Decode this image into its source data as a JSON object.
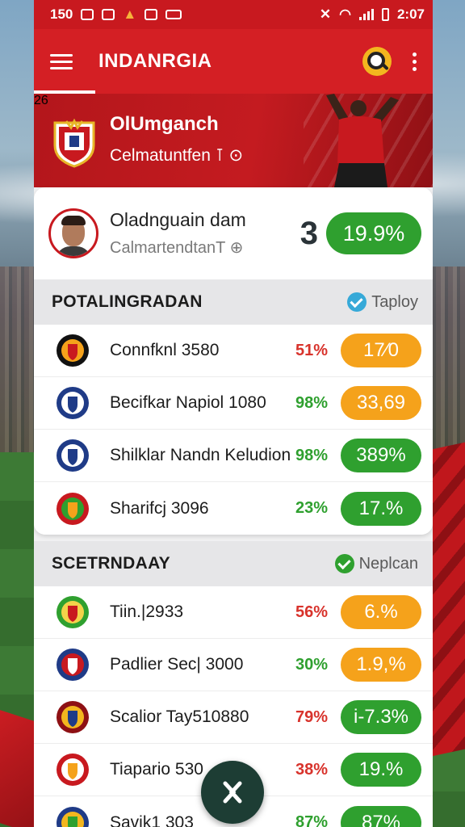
{
  "status_bar": {
    "left_time": "150",
    "right_time": "2:07"
  },
  "app_bar": {
    "title": "INDANRGIA"
  },
  "hero": {
    "name": "OlUmganch",
    "subtitle": "Celmatuntfen ⊺ ⊙",
    "jersey_number": "26"
  },
  "profile": {
    "name": "Oladnguain dam",
    "subtitle": "CalmartendtanT ⊕",
    "rank": "3",
    "score": "19.9%"
  },
  "section1": {
    "title": "POTALINGRADAN",
    "action": "Taploy",
    "rows": [
      {
        "name": "Connfknl 3580",
        "pct": "51%",
        "pct_color": "#d8332c",
        "score": "17⁄0",
        "pill_color": "#f5a21b"
      },
      {
        "name": "Becifkar Napiol 1080",
        "pct": "98%",
        "pct_color": "#2fa02f",
        "score": "33,69",
        "pill_color": "#f5a21b"
      },
      {
        "name": "Shilklar Nandn Keludion",
        "pct": "98%",
        "pct_color": "#2fa02f",
        "score": "389%",
        "pill_color": "#2fa02f"
      },
      {
        "name": "Sharifcj 3096",
        "pct": "23%",
        "pct_color": "#2fa02f",
        "score": "17.%",
        "pill_color": "#2fa02f"
      }
    ]
  },
  "section2": {
    "title": "SCETRNDAAY",
    "action": "Neplcan",
    "rows": [
      {
        "name": "Tiin.|2933",
        "pct": "56%",
        "pct_color": "#d8332c",
        "score": "6.%",
        "pill_color": "#f5a21b"
      },
      {
        "name": "Padlier Sec| 3000",
        "pct": "30%",
        "pct_color": "#2fa02f",
        "score": "1.9,%",
        "pill_color": "#f5a21b"
      },
      {
        "name": "Scalior Tay510880",
        "pct": "79%",
        "pct_color": "#d8332c",
        "score": "i-7.3%",
        "pill_color": "#2fa02f"
      },
      {
        "name": "Tiapario 530",
        "pct": "38%",
        "pct_color": "#d8332c",
        "score": "19.%",
        "pill_color": "#2fa02f"
      },
      {
        "name": "Savik1 303",
        "pct": "87%",
        "pct_color": "#2fa02f",
        "score": "87%",
        "pill_color": "#2fa02f"
      }
    ]
  },
  "colors": {
    "primary_red": "#d41f24",
    "win_green": "#2fa02f",
    "warn_orange": "#f5a21b",
    "fab": "#1d3d34"
  }
}
